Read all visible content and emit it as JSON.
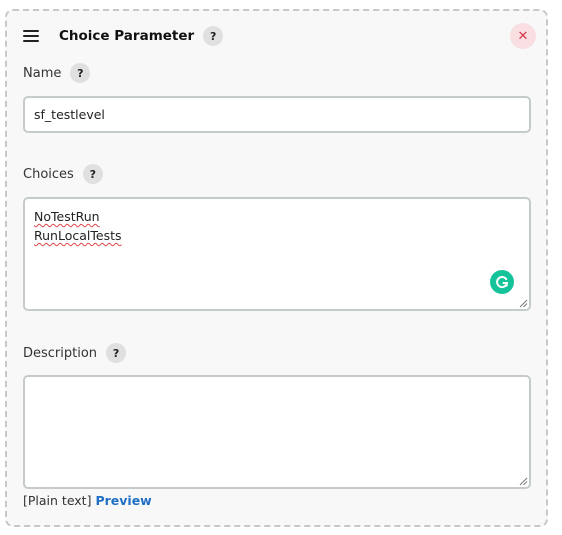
{
  "header": {
    "title": "Choice Parameter",
    "help_label": "?",
    "close_label": "✕"
  },
  "name_field": {
    "label": "Name",
    "help_label": "?",
    "value": "sf_testlevel"
  },
  "choices_field": {
    "label": "Choices",
    "help_label": "?",
    "lines": [
      "NoTestRun",
      "RunLocalTests"
    ]
  },
  "description_field": {
    "label": "Description",
    "help_label": "?",
    "value": ""
  },
  "footer": {
    "format_label": "[Plain text]",
    "preview_label": "Preview"
  },
  "colors": {
    "accent_link": "#1f6fc5",
    "close_bg": "#f9dfe1",
    "close_fg": "#d2384a",
    "grammarly": "#15c39a"
  }
}
